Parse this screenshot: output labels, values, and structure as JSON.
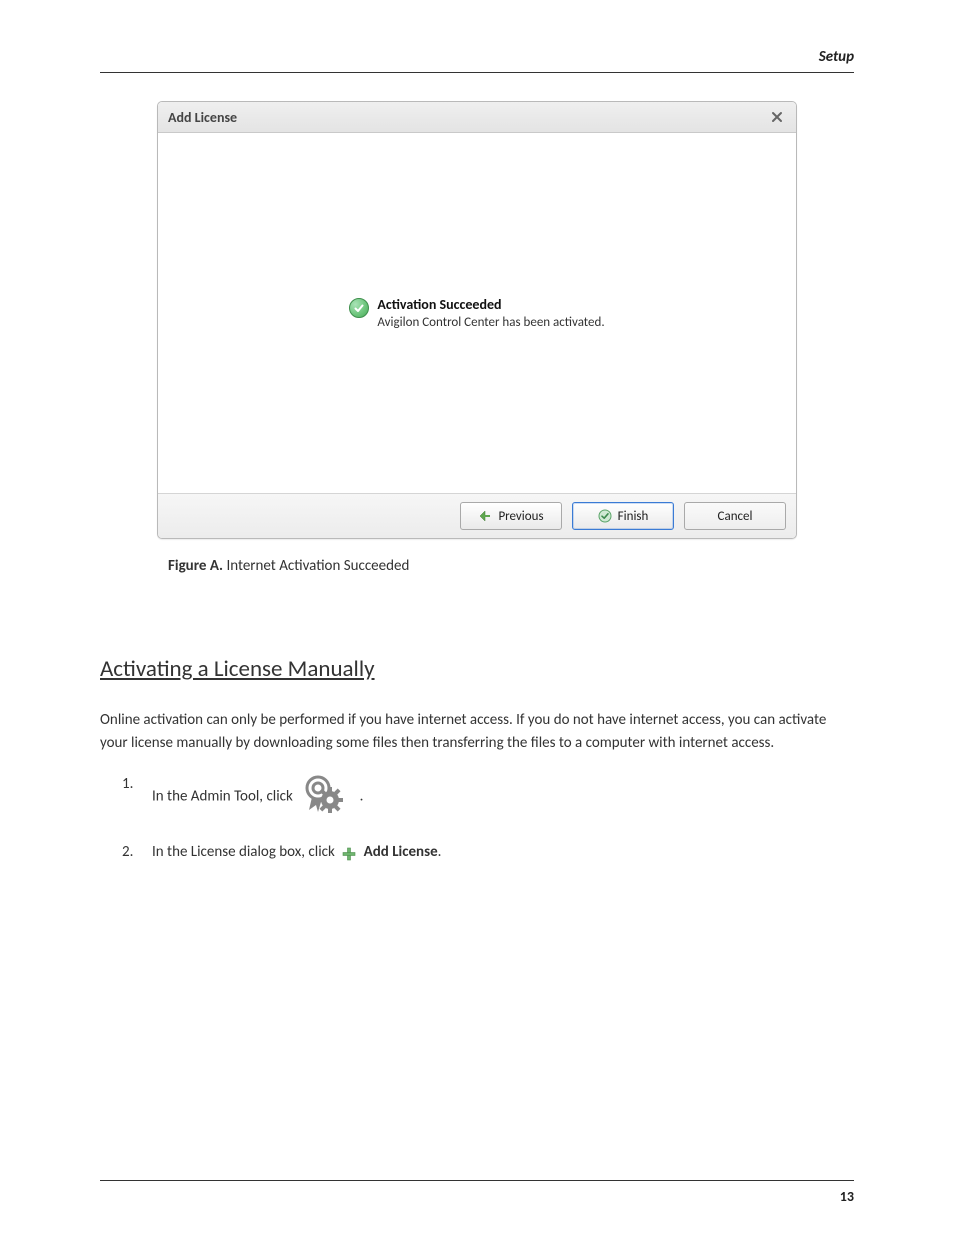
{
  "header": {
    "section_label": "Setup"
  },
  "dialog": {
    "title": "Add License",
    "success": {
      "heading": "Activation Succeeded",
      "message": "Avigilon Control Center has been activated."
    },
    "buttons": {
      "previous": "Previous",
      "finish": "Finish",
      "cancel": "Cancel"
    }
  },
  "figure": {
    "label": "Figure A.",
    "caption": "Internet Activation Succeeded"
  },
  "section_title": "Activating a License Manually",
  "intro_para": "Online activation can only be performed if you have internet access. If you do not have internet access, you can activate your license manually by downloading some files then transferring the files to a computer with internet access.",
  "steps": {
    "s1_a": "In the Admin Tool, click",
    "s1_b": ".",
    "s2_a": "In the License dialog box, click",
    "s2_b": "Add License",
    "s2_c": "."
  },
  "page_number": "13"
}
